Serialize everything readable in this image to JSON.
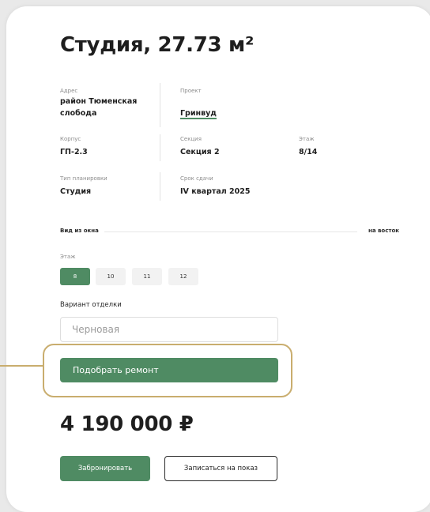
{
  "title": "Студия, 27.73 м²",
  "specs": {
    "address": {
      "label": "Адрес",
      "value_line1": "район Тюменская",
      "value_line2": "слобода"
    },
    "project": {
      "label": "Проект",
      "value": "Гринвуд"
    },
    "building": {
      "label": "Корпус",
      "value": "ГП-2.3"
    },
    "section": {
      "label": "Секция",
      "value": "Секция 2"
    },
    "floor": {
      "label": "Этаж",
      "value": "8/14"
    },
    "layout_type": {
      "label": "Тип планировки",
      "value": "Студия"
    },
    "completion": {
      "label": "Срок сдачи",
      "value": "IV квартал 2025"
    }
  },
  "window_view": {
    "label": "Вид из окна",
    "value": "на восток"
  },
  "floor_picker": {
    "label": "Этаж",
    "options": [
      "8",
      "10",
      "11",
      "12"
    ],
    "selected": "8"
  },
  "finish": {
    "label": "Вариант отделки",
    "selected": "Черновая"
  },
  "repair_button": "Подобрать ремонт",
  "price": "4 190 000 ₽",
  "actions": {
    "book": "Забронировать",
    "showing": "Записаться на показ"
  },
  "colors": {
    "accent": "#4f8b63",
    "highlight": "#c9ad6e"
  }
}
